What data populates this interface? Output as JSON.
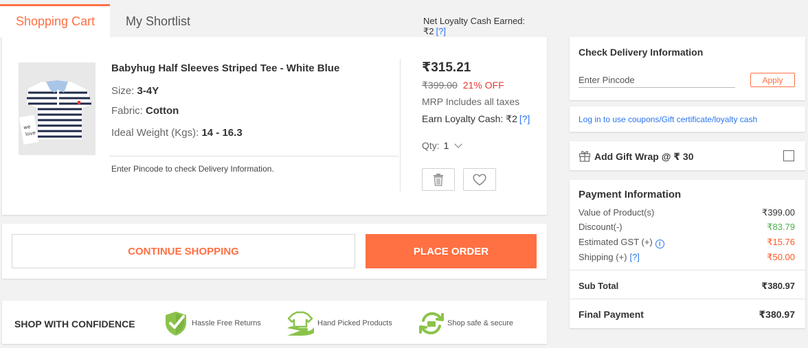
{
  "tabs": {
    "active": "Shopping Cart",
    "inactive": "My Shortlist"
  },
  "loyalty_earned": {
    "label": "Net Loyalty Cash Earned: ₹2",
    "help": "[?]"
  },
  "product": {
    "name": "Babyhug Half Sleeves Striped Tee - White Blue",
    "size_label": "Size:",
    "size_value": "3-4Y",
    "fabric_label": "Fabric:",
    "fabric_value": "Cotton",
    "weight_label": "Ideal Weight (Kgs):",
    "weight_value": "14 - 16.3",
    "pincode_note": "Enter Pincode to check Delivery Information.",
    "price": "₹315.21",
    "mrp": "₹399.00",
    "discount": "21% OFF",
    "mrp_note": "MRP Includes all taxes",
    "earn_label": "Earn Loyalty Cash: ₹2",
    "earn_help": "[?]",
    "qty_label": "Qty:",
    "qty_value": "1",
    "image_icon": "striped-tshirt-image",
    "delete_icon": "trash-icon",
    "wishlist_icon": "heart-icon"
  },
  "actions": {
    "continue_label": "CONTINUE SHOPPING",
    "place_label": "PLACE ORDER"
  },
  "confidence": {
    "title": "SHOP WITH CONFIDENCE",
    "items": [
      {
        "label": "Hassle Free Returns",
        "icon": "shield-check-icon"
      },
      {
        "label": "Hand Picked Products",
        "icon": "hand-picked-shirt-icon"
      },
      {
        "label": "Shop safe & secure",
        "icon": "secure-refresh-icon"
      }
    ]
  },
  "delivery": {
    "title": "Check Delivery Information",
    "placeholder": "Enter Pincode",
    "apply_label": "Apply"
  },
  "login": {
    "text": "Log in to use coupons/Gift certificate/loyalty cash"
  },
  "gift": {
    "label": "Add Gift Wrap @ ₹ 30",
    "checked": false,
    "icon": "gift-icon"
  },
  "payment": {
    "title": "Payment Information",
    "rows": [
      {
        "label": "Value of Product(s)",
        "value": "₹399.00"
      },
      {
        "label": "Discount(-)",
        "value": "₹83.79"
      },
      {
        "label": "Estimated GST (+)",
        "value": "₹15.76"
      },
      {
        "label": "Shipping (+)",
        "value": "₹50.00",
        "help": "[?]"
      }
    ],
    "subtotal_label": "Sub Total",
    "subtotal_value": "₹380.97",
    "final_label": "Final Payment",
    "final_value": "₹380.97"
  },
  "colors": {
    "accent": "#ff7043",
    "link": "#2874f0",
    "green": "#4caf50",
    "confidence_green": "#8bc34a"
  }
}
